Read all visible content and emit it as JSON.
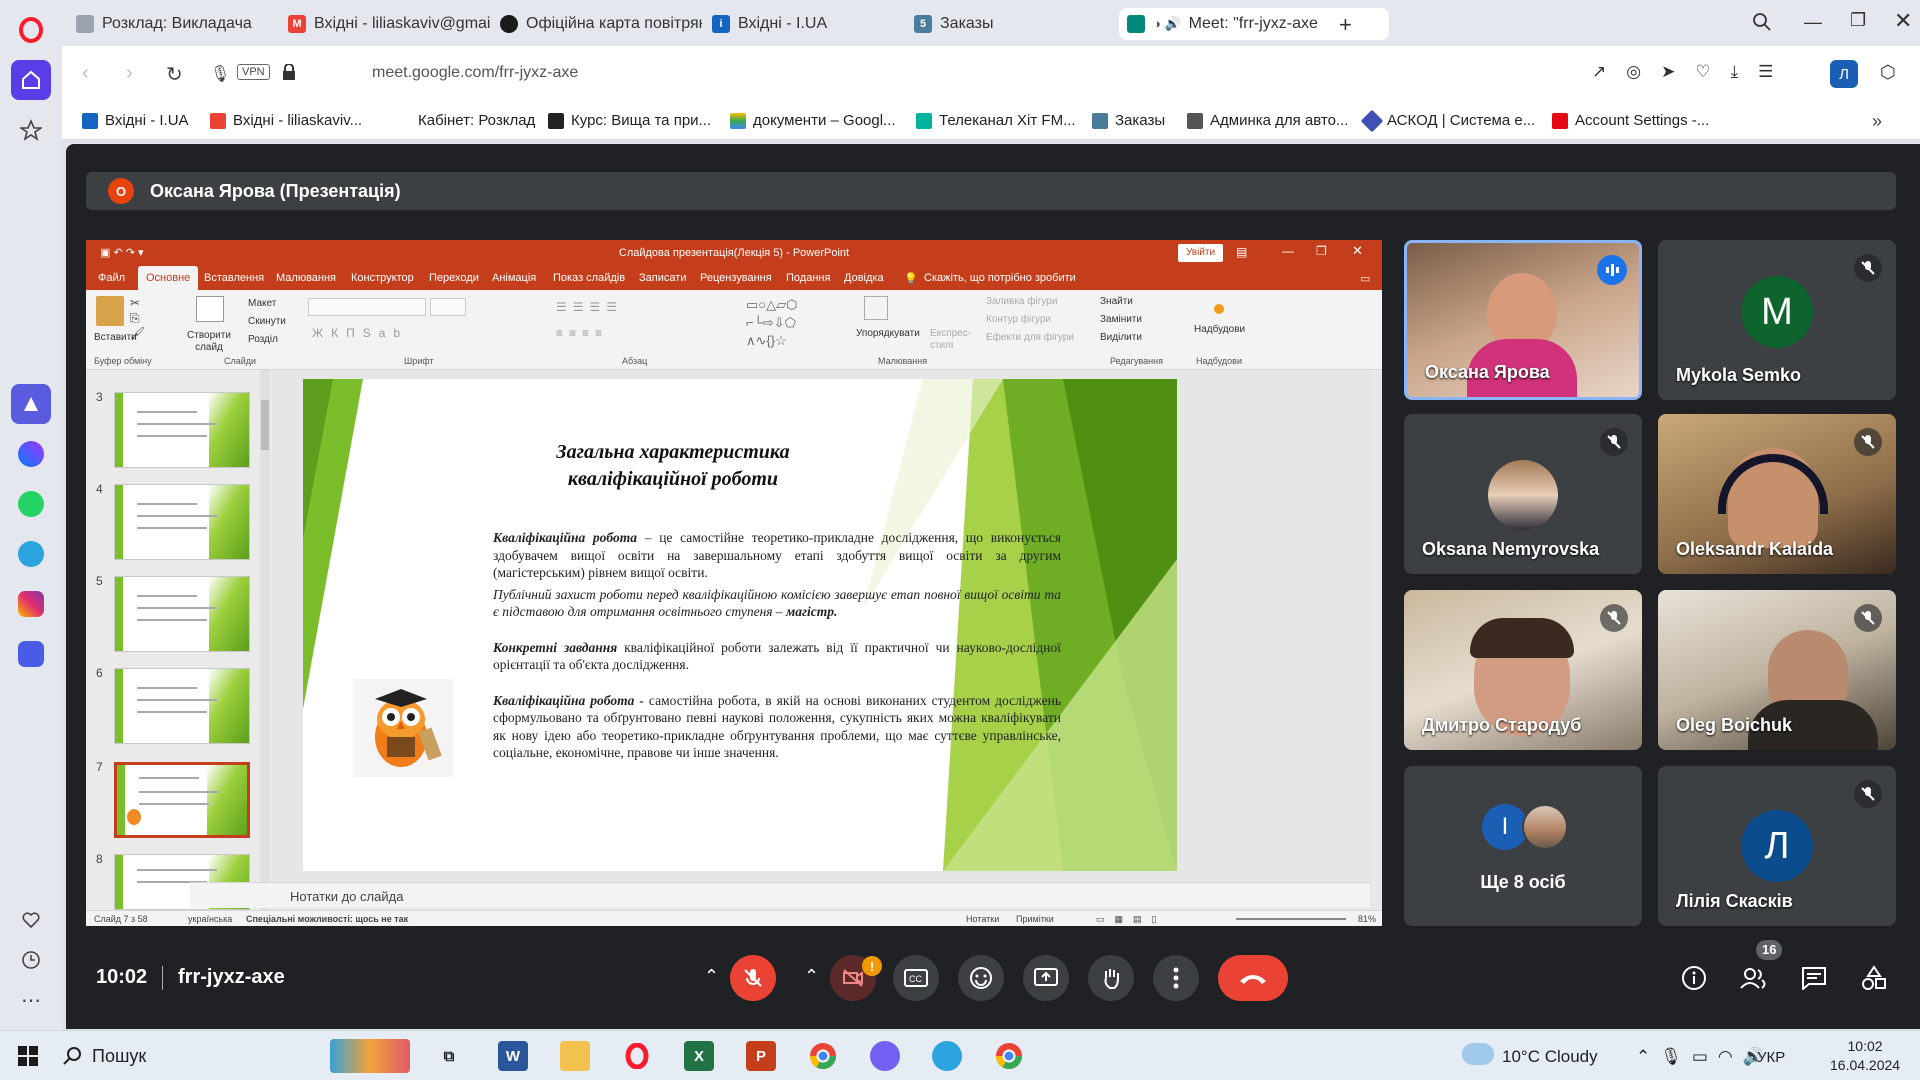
{
  "browser": {
    "tabs": [
      {
        "label": "Розклад: Викладача",
        "color": "#9aa4b1"
      },
      {
        "label": "Вхідні - liliaskaviv@gmai",
        "color": "#ea4335"
      },
      {
        "label": "Офіційна карта повітрян",
        "color": "#1a1a1a"
      },
      {
        "label": "Вхідні - I.UA",
        "color": "#1565c0"
      },
      {
        "label": "Заказы",
        "color": "#4a7c9b"
      },
      {
        "label": "Meet: \"frr-jyxz-axe",
        "color": "#00897b"
      }
    ],
    "url": "meet.google.com/frr-jyxz-axe",
    "vpn_label": "VPN",
    "profile_initial": "Л",
    "bookmarks": [
      {
        "label": "Вхідні - I.UA",
        "color": "#1565c0"
      },
      {
        "label": "Вхідні - liliaskaviv...",
        "color": "#ea4335"
      },
      {
        "label": "Кабінет: Розклад",
        "color": "#ffffff"
      },
      {
        "label": "Курс: Вища та при...",
        "color": "#222222"
      },
      {
        "label": "документи – Googl...",
        "color": "#fbbc04"
      },
      {
        "label": "Телеканал Хіт FM...",
        "color": "#00b4a0"
      },
      {
        "label": "Заказы",
        "color": "#4a7c9b"
      },
      {
        "label": "Админка для авто...",
        "color": "#555555"
      },
      {
        "label": "АСКОД | Система е...",
        "color": "#3f51b5"
      },
      {
        "label": "Account Settings -...",
        "color": "#e50914"
      }
    ]
  },
  "meet": {
    "presenter_initial": "О",
    "presenter_label": "Оксана Ярова (Презентація)",
    "time": "10:02",
    "meeting_code": "frr-jyxz-axe",
    "participants_count": "16",
    "tiles": [
      {
        "name": "Оксана Ярова"
      },
      {
        "name": "Mykola Semko",
        "initial": "M"
      },
      {
        "name": "Oksana Nemyrovska"
      },
      {
        "name": "Oleksandr Kalaida"
      },
      {
        "name": "Дмитро Стародуб"
      },
      {
        "name": "Oleg Boichuk"
      },
      {
        "name": "Ще 8 осіб",
        "initial": "I"
      },
      {
        "name": "Лілія Скасків",
        "initial": "Л"
      }
    ],
    "alert_badge": "!"
  },
  "ppt": {
    "title": "Слайдова презентація(Лекція 5)  -  PowerPoint",
    "signin": "Увійти",
    "tabs": [
      "Файл",
      "Основне",
      "Вставлення",
      "Малювання",
      "Конструктор",
      "Переходи",
      "Анімація",
      "Показ слайдів",
      "Записати",
      "Рецензування",
      "Подання",
      "Довідка"
    ],
    "tell_me": "Скажіть, що потрібно зробити",
    "ribbon": {
      "paste": "Вставити",
      "create_slide": "Створити слайд",
      "layout": "Макет",
      "reset": "Скинути",
      "section": "Розділ",
      "shapes": "Упорядкувати",
      "styles": "Експрес-стилі",
      "fill": "Заливка фігури",
      "outline": "Контур фігури",
      "effects": "Ефекти для фігури",
      "find": "Знайти",
      "replace": "Замінити",
      "select": "Виділити",
      "addins": "Надбудови",
      "groups": [
        "Буфер обміну",
        "Слайди",
        "Шрифт",
        "Абзац",
        "Малювання",
        "Редагування",
        "Надбудови"
      ]
    },
    "thumb_numbers": [
      "3",
      "4",
      "5",
      "6",
      "7",
      "8"
    ],
    "notes_placeholder": "Нотатки до слайда",
    "status": {
      "slide": "Слайд 7 з 58",
      "lang": "українська",
      "access": "Спеціальні можливості: щось не так",
      "notes": "Нотатки",
      "comments": "Примітки",
      "zoom": "81%"
    },
    "slide": {
      "heading": "Загальна характеристика кваліфікаційної роботи",
      "p1_bold": "Кваліфікаційна робота",
      "p1_rest": " – це самостійне теоретико-прикладне дослідження, що виконується здобувачем вищої освіти на завершальному етапі здобуття вищої освіти за другим (магістерським) рівнем вищої освіти.",
      "p2": "Публічний захист роботи перед кваліфікаційною комісією завершує етап повної вищої освіти та є підставою для отримання освітнього ступеня – ",
      "p2_bold": "магістр.",
      "p3_bold": "Конкретні завдання",
      "p3_rest": " кваліфікаційної роботи залежать від її практичної чи науково-дослідної орієнтації та об'єкта дослідження.",
      "p4_bold": "Кваліфікаційна робота - ",
      "p4_rest": "самостійна робота, в якій на основі виконаних студентом досліджень сформульовано та обґрунтовано певні наукові положення, сукупність яких можна кваліфікувати як нову ідею або теоретико-прикладне обґрунтування проблеми, що має суттєве управлінське, соціальне, економічне, правове чи інше значення."
    }
  },
  "taskbar": {
    "search": "Пошук",
    "weather": "10°C  Cloudy",
    "lang": "УКР",
    "time": "10:02",
    "date": "16.04.2024"
  }
}
